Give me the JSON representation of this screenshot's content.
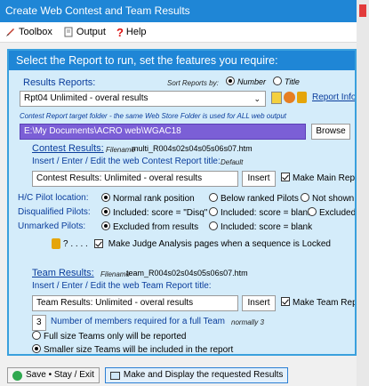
{
  "window": {
    "title": "Create Web Contest and Team Results"
  },
  "menu": {
    "toolbox": "Toolbox",
    "output": "Output",
    "help": "Help"
  },
  "panel": {
    "heading": "Select the Report to run, set the features you require:"
  },
  "reports": {
    "label": "Results Reports:",
    "sort_label": "Sort Reports by:",
    "sort_number": "Number",
    "sort_title": "Title",
    "selected": "Rpt04  Unlimited - overal results",
    "info_button": "Report Info"
  },
  "folder": {
    "note": "Contest Report target folder - the same Web Store Folder is used for ALL web output",
    "path": "E:\\My Documents\\ACRO web\\WGAC18",
    "browse": "Browse"
  },
  "contest": {
    "label": "Contest Results:",
    "filename_label": "Filename",
    "filename": "multi_R004s02s04s05s06s07.htm",
    "title_label": "Insert / Enter / Edit the web Contest Report title:",
    "default_label": "Default",
    "title_value": "Contest Results: Unlimited - overal results",
    "insert": "Insert",
    "main_report": "Make Main Report"
  },
  "options": {
    "hc_label": "H/C Pilot location:",
    "hc_opts": [
      "Normal rank position",
      "Below ranked Pilots",
      "Not shown"
    ],
    "dq_label": "Disqualified Pilots:",
    "dq_opts": [
      "Included: score = \"Disq\"",
      "Included: score = blank",
      "Excluded"
    ],
    "unm_label": "Unmarked Pilots:",
    "unm_opts": [
      "Excluded from results",
      "Included: score = blank"
    ],
    "lock_q": "? . . . .",
    "judge": "Make Judge Analysis pages when a sequence is Locked"
  },
  "team": {
    "label": "Team Results:",
    "filename_label": "Filename",
    "filename": "team_R004s02s04s05s06s07.htm",
    "title_label": "Insert / Enter / Edit the web Team Report title:",
    "title_value": "Team Results: Unlimited - overal results",
    "insert": "Insert",
    "make_team": "Make Team Report",
    "members": "3",
    "members_label": "Number of members required for a full Team",
    "normally": "normally 3",
    "full_only": "Full size Teams only will be reported",
    "smaller": "Smaller size Teams will be included in the report"
  },
  "footer": {
    "save": "Save • Stay / Exit",
    "display": "Make and Display the requested Results"
  }
}
